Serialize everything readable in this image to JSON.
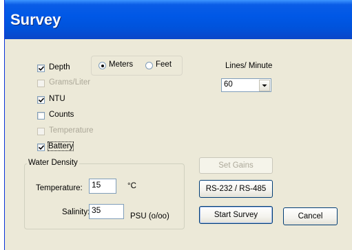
{
  "window": {
    "title": "Survey"
  },
  "measurements": {
    "depth": {
      "label": "Depth",
      "checked": true,
      "enabled": true
    },
    "grams_per_liter": {
      "label": "Grams/Liter",
      "checked": false,
      "enabled": false
    },
    "ntu": {
      "label": "NTU",
      "checked": true,
      "enabled": true
    },
    "counts": {
      "label": "Counts",
      "checked": false,
      "enabled": true
    },
    "temperature": {
      "label": "Temperature",
      "checked": false,
      "enabled": false
    },
    "battery": {
      "label": "Battery",
      "checked": true,
      "enabled": true
    }
  },
  "units": {
    "meters_label": "Meters",
    "feet_label": "Feet",
    "selected": "Meters"
  },
  "lines_per_minute": {
    "label": "Lines/ Minute",
    "value": "60"
  },
  "water_density": {
    "legend": "Water Density",
    "temperature_label": "Temperature:",
    "temperature_value": "15",
    "temperature_unit": "°C",
    "salinity_label": "Salinity:",
    "salinity_value": "35",
    "salinity_unit": "PSU (o/oo)"
  },
  "buttons": {
    "set_gains": "Set Gains",
    "rs232_485": "RS-232 / RS-485",
    "start_survey": "Start Survey",
    "cancel": "Cancel"
  },
  "colors": {
    "title_bar": "#0058e6",
    "dialog_face": "#ece9d8",
    "disabled_text": "#aca899"
  }
}
